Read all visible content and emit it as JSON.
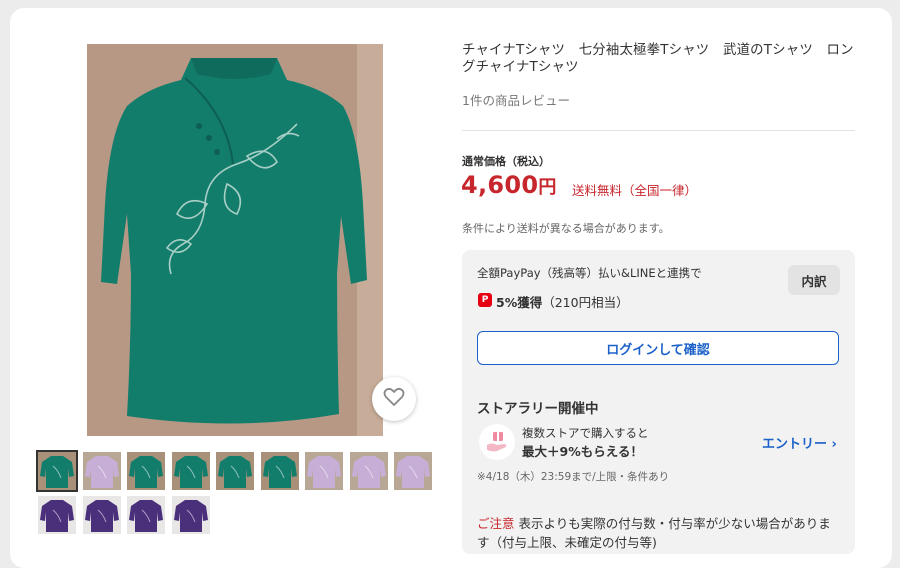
{
  "product": {
    "title": "チャイナTシャツ　七分袖太極拳Tシャツ　武道のTシャツ　ロングチャイナTシャツ",
    "reviews": "1件の商品レビュー"
  },
  "pricing": {
    "label": "通常価格（税込）",
    "amount": "4,600",
    "currency": "円",
    "shipping": "送料無料（全国一律）",
    "note": "条件により送料が異なる場合があります。"
  },
  "points": {
    "paypay_line": "全額PayPay（残高等）払い&LINEと連携で",
    "breakdown_label": "内訳",
    "paypay_badge": "P",
    "reward_bold": "5%獲得",
    "reward_sub": "（210円相当）",
    "login_label": "ログインして確認"
  },
  "rally": {
    "title": "ストアラリー開催中",
    "line1": "複数ストアで購入すると",
    "line2": "最大＋9%もらえる！",
    "entry_label": "エントリー",
    "entry_chevron": "›",
    "note": "※4/18（木）23:59まで/上限・条件あり"
  },
  "caution": {
    "label": "ご注意",
    "text": " 表示よりも実際の付与数・付与率が少ない場合があります（付与上限、未確定の付与等)"
  },
  "icons": {
    "favorite": "heart-outline-icon",
    "paypay": "paypay-icon",
    "rally": "hand-gift-icon",
    "entry": "chevron-right-icon"
  },
  "colors": {
    "accent_red": "#c8262d",
    "link_blue": "#1b61c9",
    "shirt_green": "#137d6c",
    "shirt_lilac": "#c6aed6",
    "shirt_purple": "#4a2f7a"
  },
  "thumbnails": [
    {
      "color": "green",
      "selected": true
    },
    {
      "color": "lilac"
    },
    {
      "color": "green"
    },
    {
      "color": "green"
    },
    {
      "color": "green"
    },
    {
      "color": "green"
    },
    {
      "color": "lilac"
    },
    {
      "color": "lilac"
    },
    {
      "color": "lilac"
    },
    {
      "color": "purple"
    },
    {
      "color": "purple"
    },
    {
      "color": "purple"
    },
    {
      "color": "purple"
    }
  ]
}
